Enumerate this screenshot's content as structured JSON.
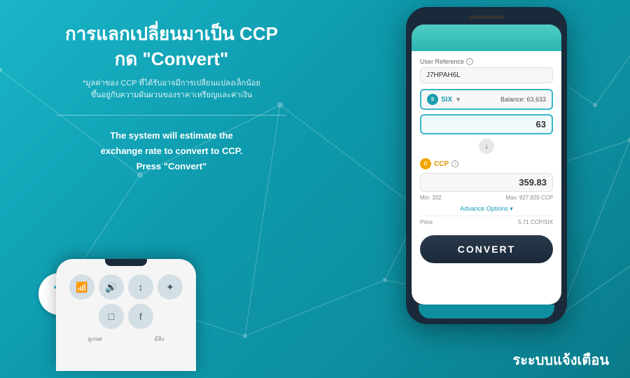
{
  "background": {
    "color_start": "#1ab5c8",
    "color_end": "#0a7a8a"
  },
  "left": {
    "title_line1": "การแลกเปลี่ยนมาเป็น CCP",
    "title_line2": "กด \"Convert\"",
    "note": "*มูลค่าของ CCP ที่ได้รับอาจมีการเปลี่ยนแปลงเล็กน้อย",
    "note2": "ขึ้นอยู่กับความผันผวนของราคาเหรียญและค่าเงิน",
    "description_line1": "The system will estimate the",
    "description_line2": "exchange rate to convert to CCP.",
    "description_line3": "Press \"Convert\"",
    "step_number": "7",
    "notification_title": "ระะบบแจ้งเตือน"
  },
  "phone": {
    "user_reference_label": "User Reference",
    "user_reference_info": "ⓘ",
    "user_reference_value": "J7HPAH6L",
    "six_label": "SIX",
    "balance_label": "Balance: 63,633",
    "amount_value": "63",
    "ccp_label": "CCP",
    "ccp_info": "ⓘ",
    "ccp_amount": "359.83",
    "min_label": "Min: 332",
    "max_label": "Max: 927,920 CCP",
    "advance_options": "Advance Options",
    "price_label": "Price",
    "price_value": "5.71 CCP/SIX",
    "convert_button_label": "CONVERT"
  },
  "phone_bottom": {
    "ctrl_icons": [
      "📶",
      "🔊",
      "↕",
      "✦",
      "□",
      "f"
    ],
    "label1": "สูภทศ",
    "label2": "มีสิง"
  }
}
